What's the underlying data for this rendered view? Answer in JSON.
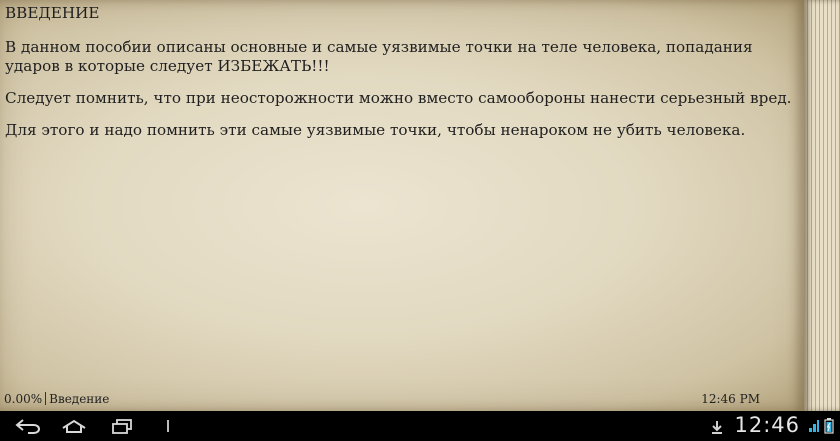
{
  "book": {
    "heading": "ВВЕДЕНИЕ",
    "paragraphs": [
      "В данном пособии описаны основные и самые уязвимые точки на теле человека, попадания ударов в которые следует ИЗБЕЖАТЬ!!!",
      "Следует помнить, что при неосторожности можно вместо самообороны нанести серьезный вред.",
      "Для этого и надо помнить эти самые уязвимые точки, чтобы ненароком не убить человека."
    ]
  },
  "status": {
    "progress": "0.00%",
    "chapter": "Введение",
    "time": "12:46 PM"
  },
  "system_bar": {
    "clock": "12:46",
    "icons": [
      "back-icon",
      "home-icon",
      "recent-apps-icon",
      "download-icon",
      "wifi-icon",
      "battery-icon"
    ]
  }
}
